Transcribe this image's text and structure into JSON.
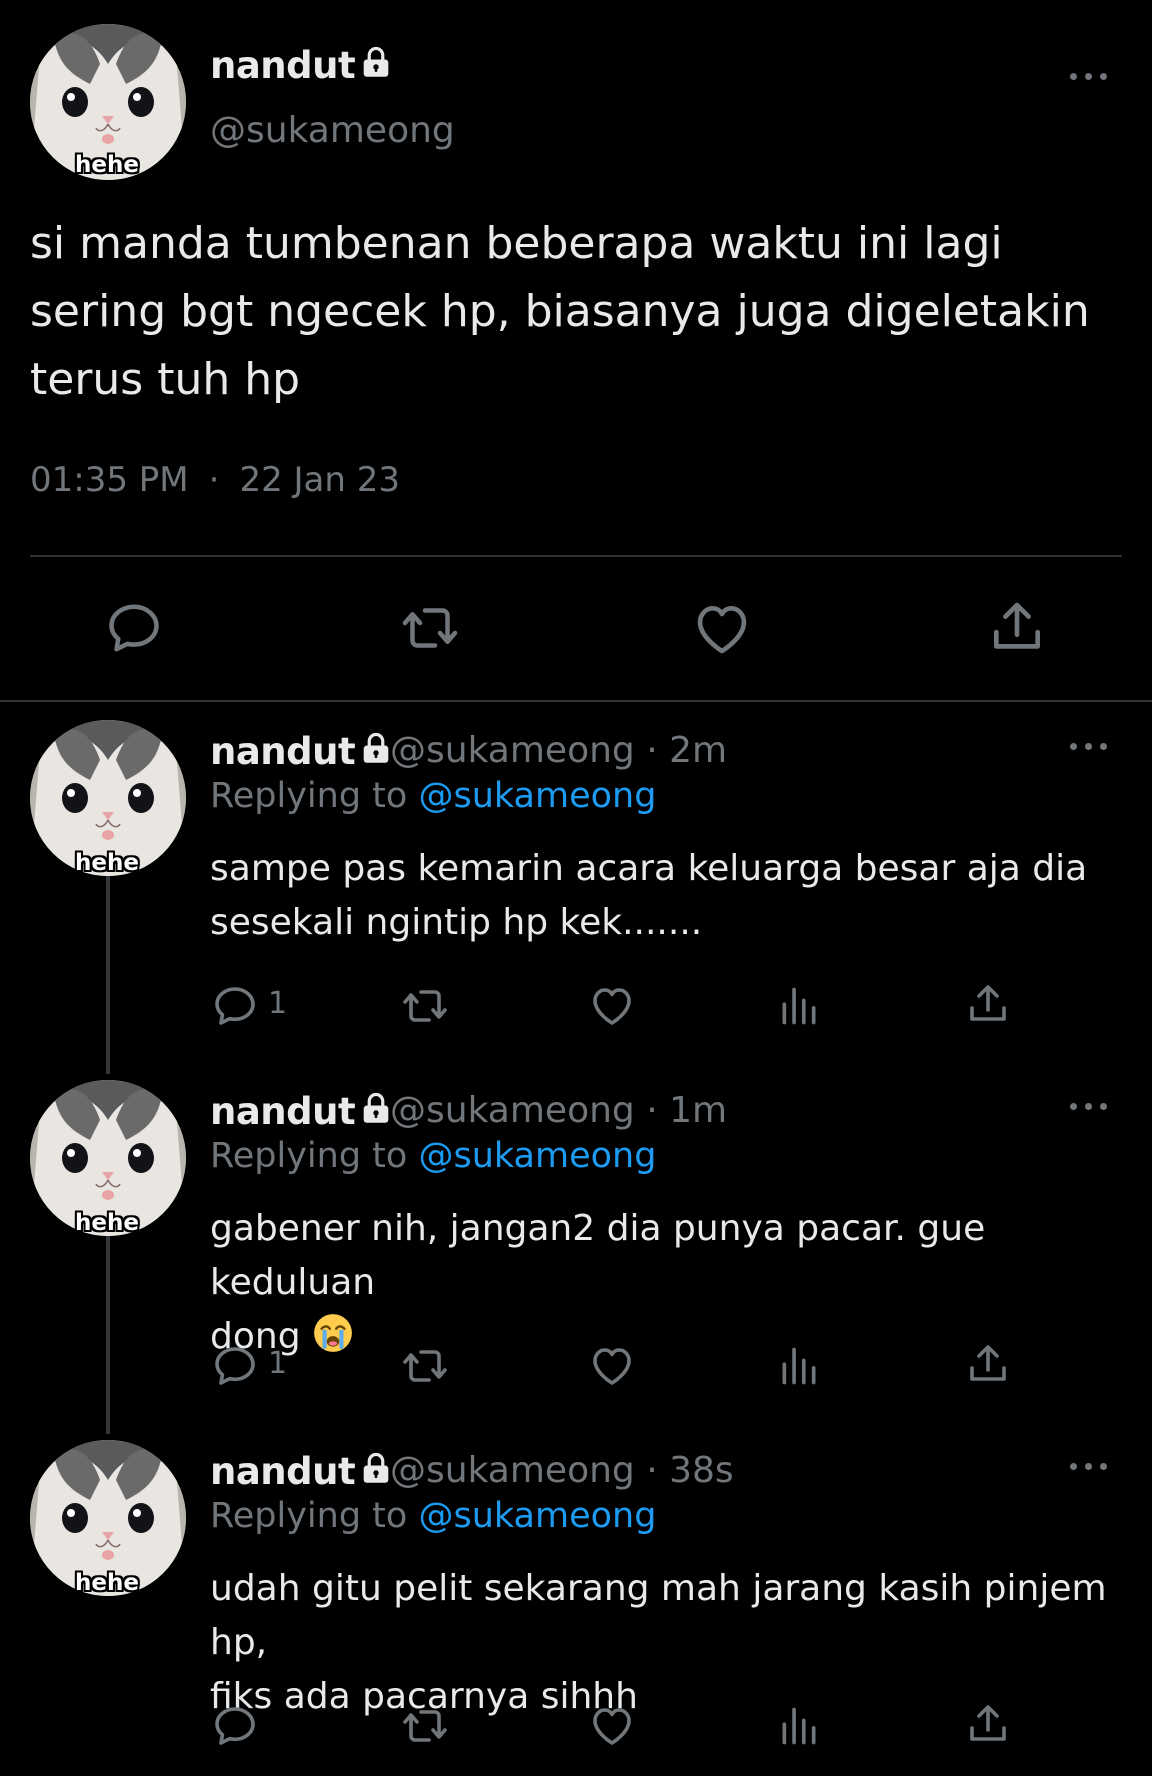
{
  "main_tweet": {
    "name": "nandut",
    "handle": "@sukameong",
    "avatar_label": "hehe",
    "text": "si manda tumbenan beberapa waktu ini lagi sering bgt ngecek hp, biasanya juga digeletakin terus tuh hp",
    "time": "01:35 PM",
    "separator": "·",
    "date": "22 Jan 23"
  },
  "replies": [
    {
      "name": "nandut",
      "handle": "@sukameong",
      "age": "2m",
      "replying_prefix": "Replying to",
      "replying_handle": "@sukameong",
      "avatar_label": "hehe",
      "text_line1": "sampe pas kemarin acara keluarga besar aja dia",
      "text_line2": "sesekali ngintip hp kek.......",
      "reply_count": "1"
    },
    {
      "name": "nandut",
      "handle": "@sukameong",
      "age": "1m",
      "replying_prefix": "Replying to",
      "replying_handle": "@sukameong",
      "avatar_label": "hehe",
      "text_line1": "gabener nih, jangan2 dia punya pacar. gue keduluan",
      "text_line2": "dong",
      "emoji": "loudly-crying-face",
      "reply_count": "1"
    },
    {
      "name": "nandut",
      "handle": "@sukameong",
      "age": "38s",
      "replying_prefix": "Replying to",
      "replying_handle": "@sukameong",
      "avatar_label": "hehe",
      "text_line1": "udah gitu pelit sekarang mah jarang kasih pinjem hp,",
      "text_line2": "fiks ada pacarnya sihhh",
      "reply_count": ""
    }
  ],
  "colors": {
    "background": "#000000",
    "text": "#e7e9ea",
    "muted": "#71767b",
    "link": "#1d9bf0",
    "divider": "#2f3336"
  },
  "icons": [
    "lock-icon",
    "more-icon",
    "reply-icon",
    "retweet-icon",
    "like-icon",
    "share-icon",
    "views-icon"
  ]
}
